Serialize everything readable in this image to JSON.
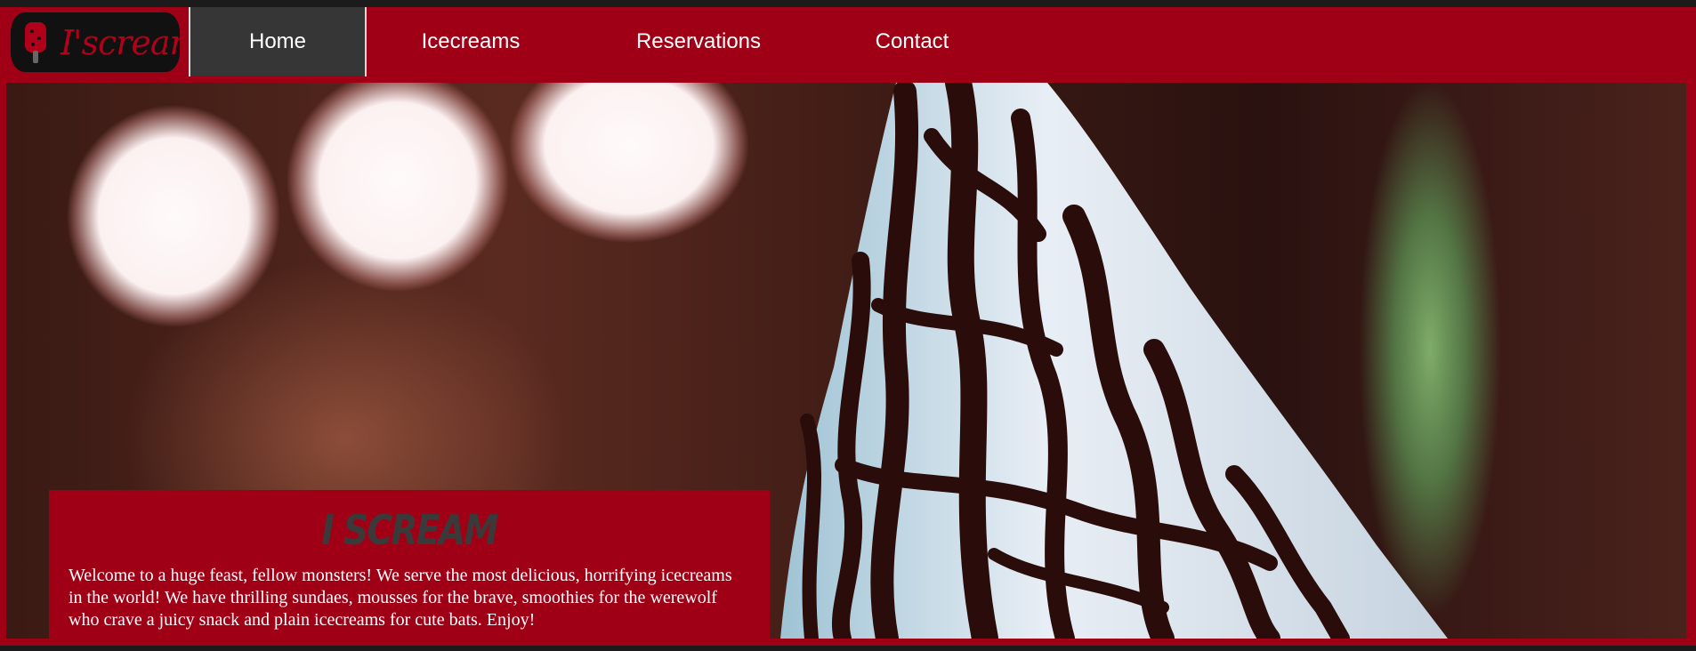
{
  "logo": {
    "text": "I'scream",
    "icon": "popsicle-icon"
  },
  "nav": {
    "items": [
      {
        "label": "Home",
        "active": true
      },
      {
        "label": "Icecreams",
        "active": false
      },
      {
        "label": "Reservations",
        "active": false
      },
      {
        "label": "Contact",
        "active": false
      }
    ]
  },
  "hero": {
    "card_title": "I SCREAM",
    "card_text": "Welcome to a huge feast, fellow monsters! We serve the most delicious, horrifying icecreams in the world! We have thrilling sundaes, mousses for the brave, smoothies for the werewolf who crave a juicy snack and plain icecreams for cute bats. Enjoy!"
  },
  "colors": {
    "brand": "#a00015",
    "active_nav": "#363636",
    "background": "#1b1b1b"
  }
}
